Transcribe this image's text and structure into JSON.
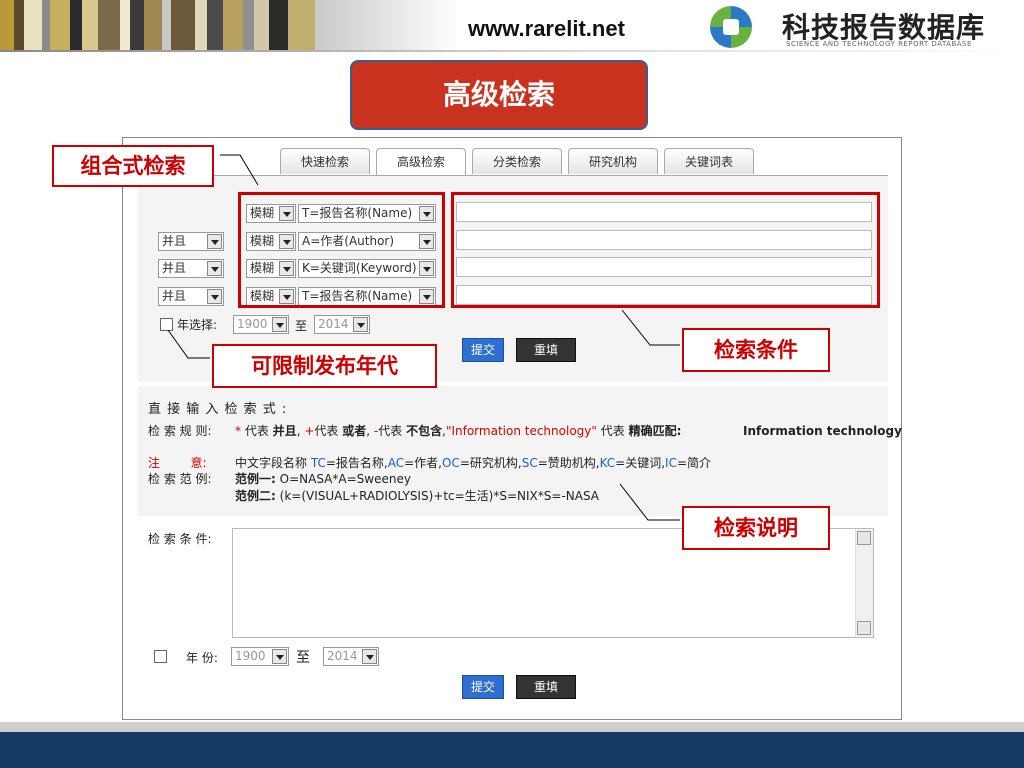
{
  "header": {
    "site_url": "www.rarelit.net",
    "logo_cn": "科技报告数据库",
    "logo_en": "SCIENCE AND TECHNOLOGY REPORT DATABASE",
    "stripe_colors": [
      "#b89a3a",
      "#5a4a2a",
      "#e8e0c0",
      "#8a8a8a",
      "#c4b060",
      "#2a2a2a",
      "#d8c890",
      "#7a6a4a",
      "#f0e8d0",
      "#3a3a3a",
      "#a08850",
      "#c8c8c8",
      "#6a5a3a",
      "#e0d8b8",
      "#4a4a4a",
      "#b8a060",
      "#909090",
      "#d0c8a8",
      "#2a2a2a",
      "#c0b070"
    ]
  },
  "title": "高级检索",
  "tabs": [
    {
      "label": "快速检索",
      "active": false
    },
    {
      "label": "高级检索",
      "active": true
    },
    {
      "label": "分类检索",
      "active": false
    },
    {
      "label": "研究机构",
      "active": false
    },
    {
      "label": "关键词表",
      "active": false
    }
  ],
  "form": {
    "rows": [
      {
        "logic": "",
        "match": "模糊",
        "field": "T=报告名称(Name)"
      },
      {
        "logic": "并且",
        "match": "模糊",
        "field": "A=作者(Author)"
      },
      {
        "logic": "并且",
        "match": "模糊",
        "field": "K=关键词(Keyword)"
      },
      {
        "logic": "并且",
        "match": "模糊",
        "field": "T=报告名称(Name)"
      }
    ],
    "year_label": "年选择:",
    "year_from": "1900",
    "to": "至",
    "year_to": "2014",
    "submit": "提交",
    "reset": "重填"
  },
  "direct": {
    "heading": "直 接 输 入 检 索 式 :",
    "rule_label": "检 索 规 则:",
    "rule_text_1": "代表",
    "rule_and": "并且",
    "rule_text_2": "代表",
    "rule_or": "或者",
    "rule_text_3": "代表",
    "rule_not": "不包含",
    "rule_phrase": "\"Information technology\"",
    "rule_text_4": "代表",
    "rule_exact": "精确匹配:",
    "rule_exact_val": "Information technology",
    "note_label": "注        意:",
    "note_text": "中文字段名称",
    "fields": [
      {
        "code": "TC",
        "desc": "=报告名称,"
      },
      {
        "code": "AC",
        "desc": "=作者,"
      },
      {
        "code": "OC",
        "desc": "=研究机构,"
      },
      {
        "code": "SC",
        "desc": "=赞助机构,"
      },
      {
        "code": "KC",
        "desc": "=关键词,"
      },
      {
        "code": "IC",
        "desc": "=简介"
      }
    ],
    "example_label": "检 索 范 例:",
    "example1_label": "范例一:",
    "example1": "O=NASA*A=Sweeney",
    "example2_label": "范例二:",
    "example2": "(k=(VISUAL+RADIOLYSIS)+tc=生活)*S=NIX*S=-NASA",
    "cond_label": "检 索 条 件:",
    "year_label": "年 份:",
    "year_from": "1900",
    "to": "至",
    "year_to": "2014",
    "submit": "提交",
    "reset": "重填"
  },
  "callouts": {
    "combo": "组合式检索",
    "condition": "检索条件",
    "year": "可限制发布年代",
    "explain": "检索说明"
  },
  "colors": {
    "title_bg": "#c8321e",
    "callout_red": "#cc0000",
    "footer_blue": "#163a66",
    "button_blue": "#2f6fd1"
  }
}
